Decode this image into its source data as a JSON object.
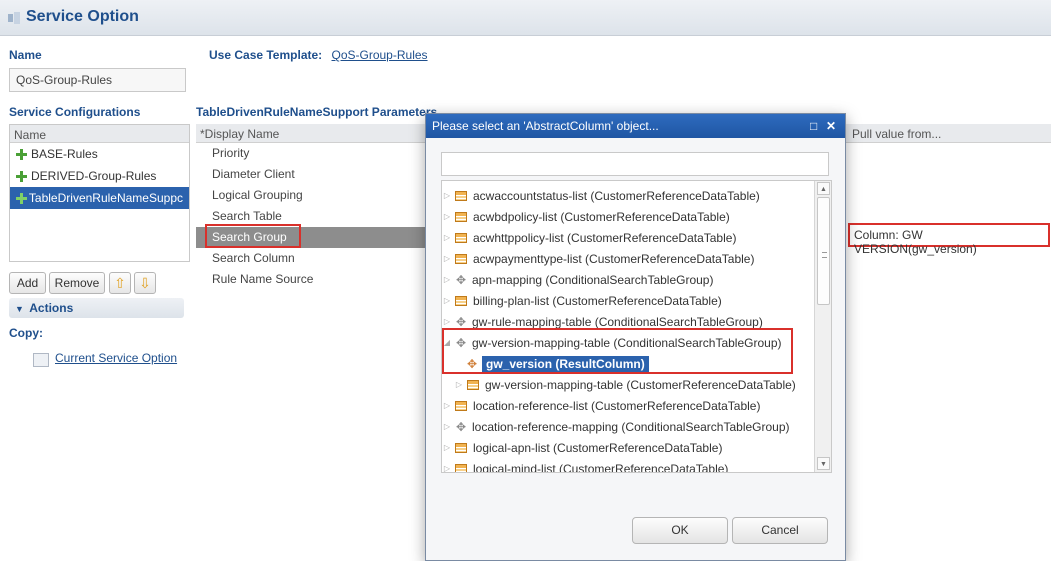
{
  "header": {
    "title": "Service Option",
    "icon": "service-option-icon"
  },
  "name_section": {
    "label": "Name",
    "value": "QoS-Group-Rules"
  },
  "use_case": {
    "label": "Use Case Template:",
    "link": "QoS-Group-Rules"
  },
  "service_configurations": {
    "label": "Service Configurations",
    "column_header": "Name",
    "items": [
      {
        "label": "BASE-Rules"
      },
      {
        "label": "DERIVED-Group-Rules"
      },
      {
        "label": "TableDrivenRuleNameSuppc"
      }
    ],
    "buttons": {
      "add": "Add",
      "remove": "Remove"
    }
  },
  "actions": {
    "label": "Actions",
    "copy_label": "Copy:",
    "current_service_option": "Current Service Option"
  },
  "parameters": {
    "title": "TableDrivenRuleNameSupport Parameters",
    "column_display_name": "*Display Name",
    "column_pull_value": "Pull value from...",
    "rows": [
      "Priority",
      "Diameter Client",
      "Logical Grouping",
      "Search Table",
      "Search Group",
      "Search Column",
      "Rule Name Source"
    ],
    "search_group_value": "Column: GW VERSION(gw_version)"
  },
  "dialog": {
    "title": "Please select an 'AbstractColumn' object...",
    "filter_value": "",
    "tree": [
      {
        "label": "acwaccountstatus-list (CustomerReferenceDataTable)",
        "icon": "table-icon"
      },
      {
        "label": "acwbdpolicy-list (CustomerReferenceDataTable)",
        "icon": "table-icon"
      },
      {
        "label": "acwhttppolicy-list (CustomerReferenceDataTable)",
        "icon": "table-icon"
      },
      {
        "label": "acwpaymenttype-list (CustomerReferenceDataTable)",
        "icon": "table-icon"
      },
      {
        "label": "apn-mapping (ConditionalSearchTableGroup)",
        "icon": "group-icon"
      },
      {
        "label": "billing-plan-list (CustomerReferenceDataTable)",
        "icon": "table-icon"
      },
      {
        "label": "gw-rule-mapping-table (ConditionalSearchTableGroup)",
        "icon": "group-icon"
      },
      {
        "label": "gw-version-mapping-table (ConditionalSearchTableGroup)",
        "icon": "group-icon"
      },
      {
        "label": "gw_version (ResultColumn)",
        "icon": "result-column-icon"
      },
      {
        "label": "gw-version-mapping-table (CustomerReferenceDataTable)",
        "icon": "table-icon"
      },
      {
        "label": "location-reference-list (CustomerReferenceDataTable)",
        "icon": "table-icon"
      },
      {
        "label": "location-reference-mapping (ConditionalSearchTableGroup)",
        "icon": "group-icon"
      },
      {
        "label": "logical-apn-list (CustomerReferenceDataTable)",
        "icon": "table-icon"
      },
      {
        "label": "logical-mind-list (CustomerReferenceDataTable)",
        "icon": "table-icon"
      }
    ],
    "ok": "OK",
    "cancel": "Cancel"
  },
  "colors": {
    "accent": "#1f4f8c",
    "selection": "#2b62ad",
    "highlight": "#d9302b"
  }
}
